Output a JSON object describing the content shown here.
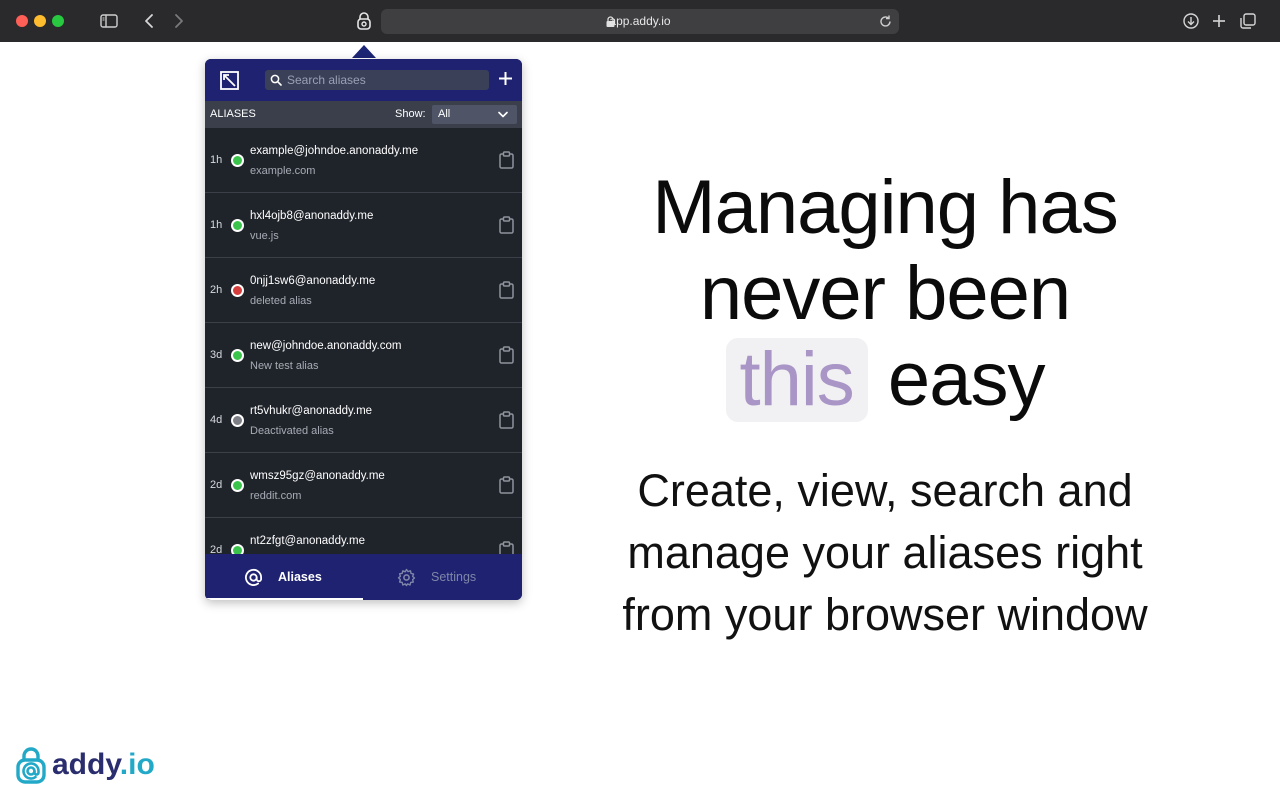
{
  "browser": {
    "url": "app.addy.io",
    "icons": [
      "sidebar-icon",
      "back-icon",
      "forward-icon",
      "extension-icon",
      "lock-icon",
      "reload-icon",
      "download-icon",
      "new-tab-icon",
      "tabs-overview-icon"
    ]
  },
  "popup": {
    "search_placeholder": "Search aliases",
    "aliases_heading": "ALIASES",
    "show_label": "Show:",
    "show_value": "All",
    "aliases": [
      {
        "age": "1h",
        "email": "example@johndoe.anonaddy.me",
        "description": "example.com",
        "status": "active"
      },
      {
        "age": "1h",
        "email": "hxl4ojb8@anonaddy.me",
        "description": "vue.js",
        "status": "active"
      },
      {
        "age": "2h",
        "email": "0njj1sw6@anonaddy.me",
        "description": "deleted alias",
        "status": "deleted"
      },
      {
        "age": "3d",
        "email": "new@johndoe.anonaddy.com",
        "description": "New test alias",
        "status": "active"
      },
      {
        "age": "4d",
        "email": "rt5vhukr@anonaddy.me",
        "description": "Deactivated alias",
        "status": "inactive"
      },
      {
        "age": "2d",
        "email": "wmsz95gz@anonaddy.me",
        "description": "reddit.com",
        "status": "active"
      },
      {
        "age": "2d",
        "email": "nt2zfgt@anonaddy.me",
        "description": "",
        "status": "active"
      }
    ],
    "tabs": {
      "aliases": "Aliases",
      "settings": "Settings"
    },
    "colors": {
      "header": "#1e2270",
      "body": "#1f232a",
      "active": "#3bc44c",
      "deleted": "#d63d3d",
      "inactive": "#7c7f85"
    }
  },
  "hero": {
    "headline_line1": "Managing has",
    "headline_line2": "never been",
    "headline_highlight": "this",
    "headline_end": "easy",
    "subline_line1": "Create, view, search and",
    "subline_line2": "manage your aliases right",
    "subline_line3": "from your browser window",
    "highlight_color": "#a995c6"
  },
  "brand": {
    "name": "addy",
    "tld": ".io"
  }
}
